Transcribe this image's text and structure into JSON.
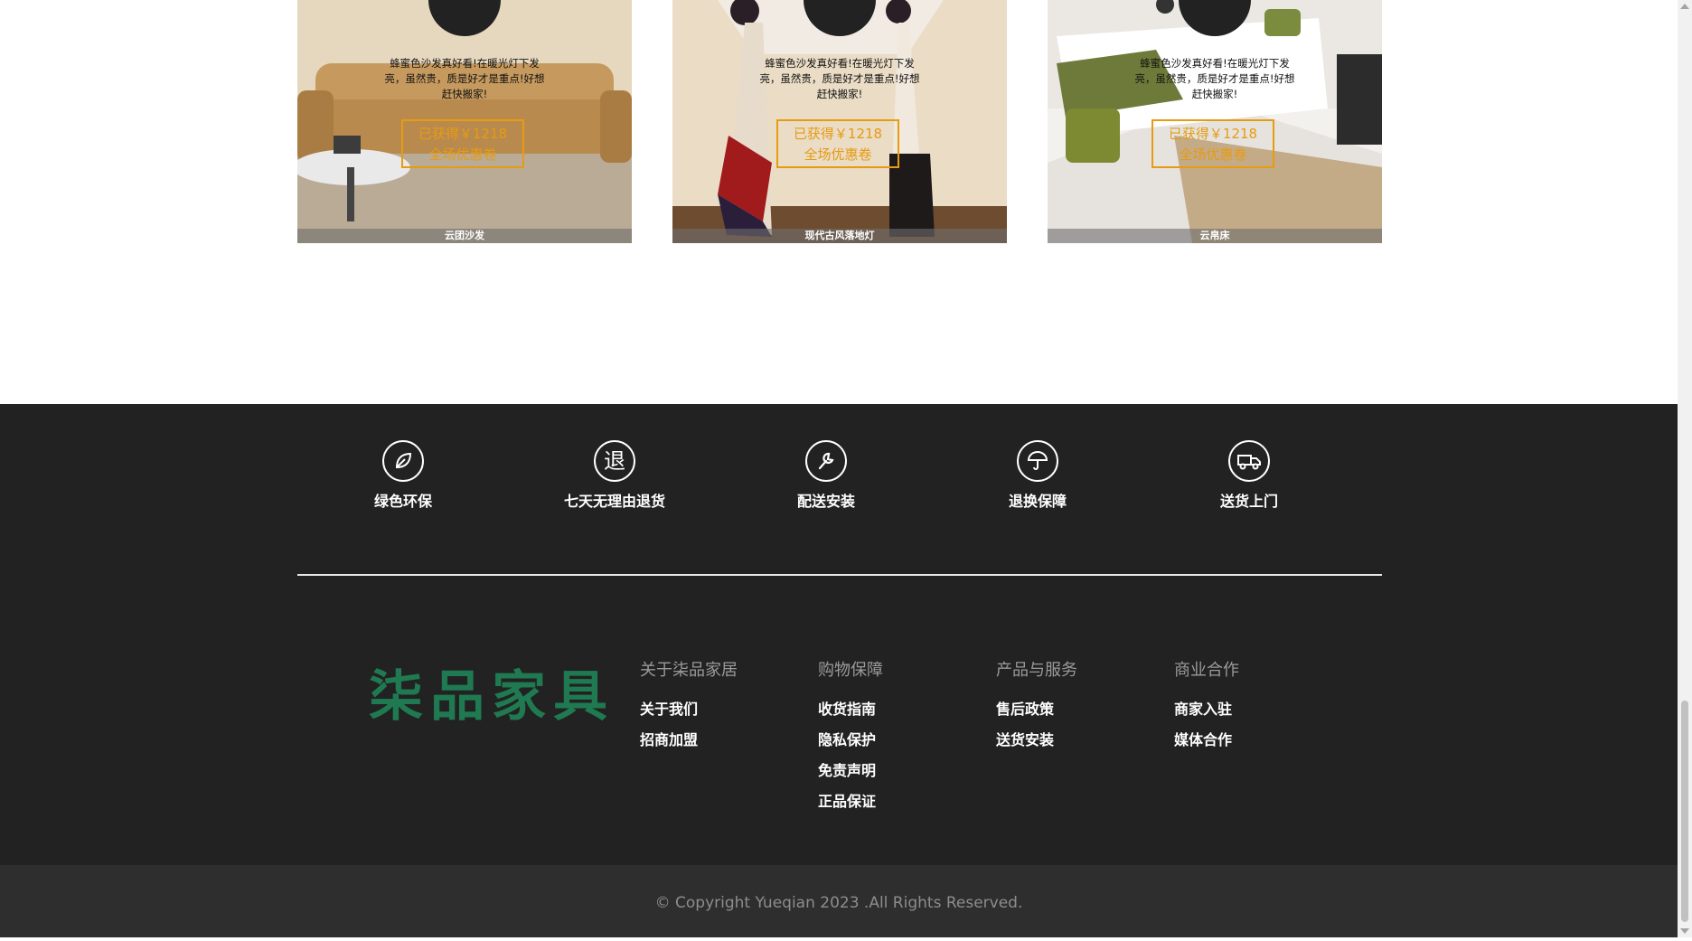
{
  "products": [
    {
      "desc": "蜂蜜色沙发真好看!在暖光灯下发亮，虽然贵，质是好才是重点!好想赶快搬家!",
      "coupon_line1": "已获得￥1218",
      "coupon_line2": "全场优惠卷",
      "caption": "云团沙发"
    },
    {
      "desc": "蜂蜜色沙发真好看!在暖光灯下发亮，虽然贵，质是好才是重点!好想赶快搬家!",
      "coupon_line1": "已获得￥1218",
      "coupon_line2": "全场优惠卷",
      "caption": "现代古风落地灯"
    },
    {
      "desc": "蜂蜜色沙发真好看!在暖光灯下发亮，虽然贵，质是好才是重点!好想赶快搬家!",
      "coupon_line1": "已获得￥1218",
      "coupon_line2": "全场优惠卷",
      "caption": "云帛床"
    }
  ],
  "features": [
    {
      "icon": "leaf-icon",
      "label": "绿色环保"
    },
    {
      "icon": "return-icon",
      "label": "七天无理由退货"
    },
    {
      "icon": "wrench-icon",
      "label": "配送安装"
    },
    {
      "icon": "umbrella-icon",
      "label": "退换保障"
    },
    {
      "icon": "delivery-truck-icon",
      "label": "送货上门"
    }
  ],
  "logo": "柒品家具",
  "columns": [
    {
      "title": "关于柒品家居",
      "links": [
        "关于我们",
        "招商加盟"
      ]
    },
    {
      "title": "购物保障",
      "links": [
        "收货指南",
        "隐私保护",
        "免责声明",
        "正品保证"
      ]
    },
    {
      "title": "产品与服务",
      "links": [
        "售后政策",
        "送货安装"
      ]
    },
    {
      "title": "商业合作",
      "links": [
        "商家入驻",
        "媒体合作"
      ]
    }
  ],
  "copyright": "© Copyright Yueqian 2023 .All Rights Reserved.",
  "colors": {
    "accent": "#e69b12",
    "footer_bg": "#222222",
    "logo": "#1f7a52"
  }
}
